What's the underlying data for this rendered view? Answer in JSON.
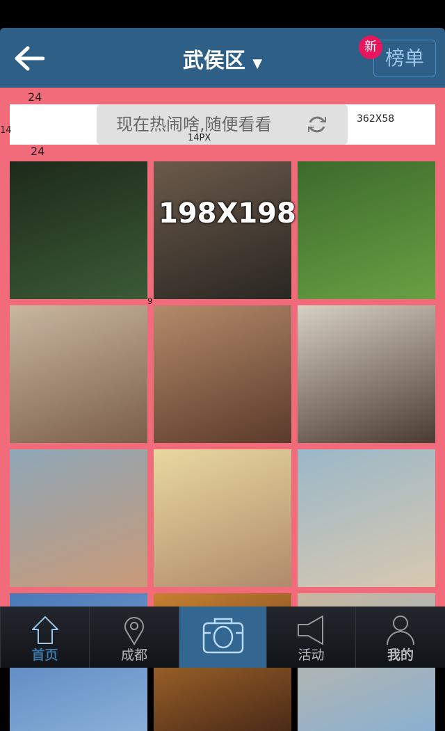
{
  "header": {
    "title": "武侯区",
    "rank_label": "榜单",
    "new_badge": "新"
  },
  "banner": {
    "text": "现在热闹啥,随便看看"
  },
  "annotations": {
    "top_gap": "24",
    "bottom_gap": "24",
    "left_margin": "14",
    "font_size": "14PX",
    "banner_size": "362X58",
    "photo_size": "198X198",
    "photo_gap": "9"
  },
  "photos": [
    "waterfall",
    "music-studio",
    "garden",
    "family-dinner",
    "man-cherries",
    "girl-guitar",
    "family-selfie",
    "smiling-man",
    "woman-beach",
    "sky",
    "drinks",
    "street"
  ],
  "tabs": [
    {
      "label": "首页",
      "icon": "home-icon",
      "active": true
    },
    {
      "label": "成都",
      "icon": "location-pin-icon"
    },
    {
      "label": "",
      "icon": "camera-icon"
    },
    {
      "label": "活动",
      "icon": "megaphone-icon"
    },
    {
      "label": "我的",
      "icon": "user-icon"
    }
  ],
  "colors": {
    "header": "#2e5f87",
    "background": "#f26b7a",
    "active_tab": "#336690"
  }
}
